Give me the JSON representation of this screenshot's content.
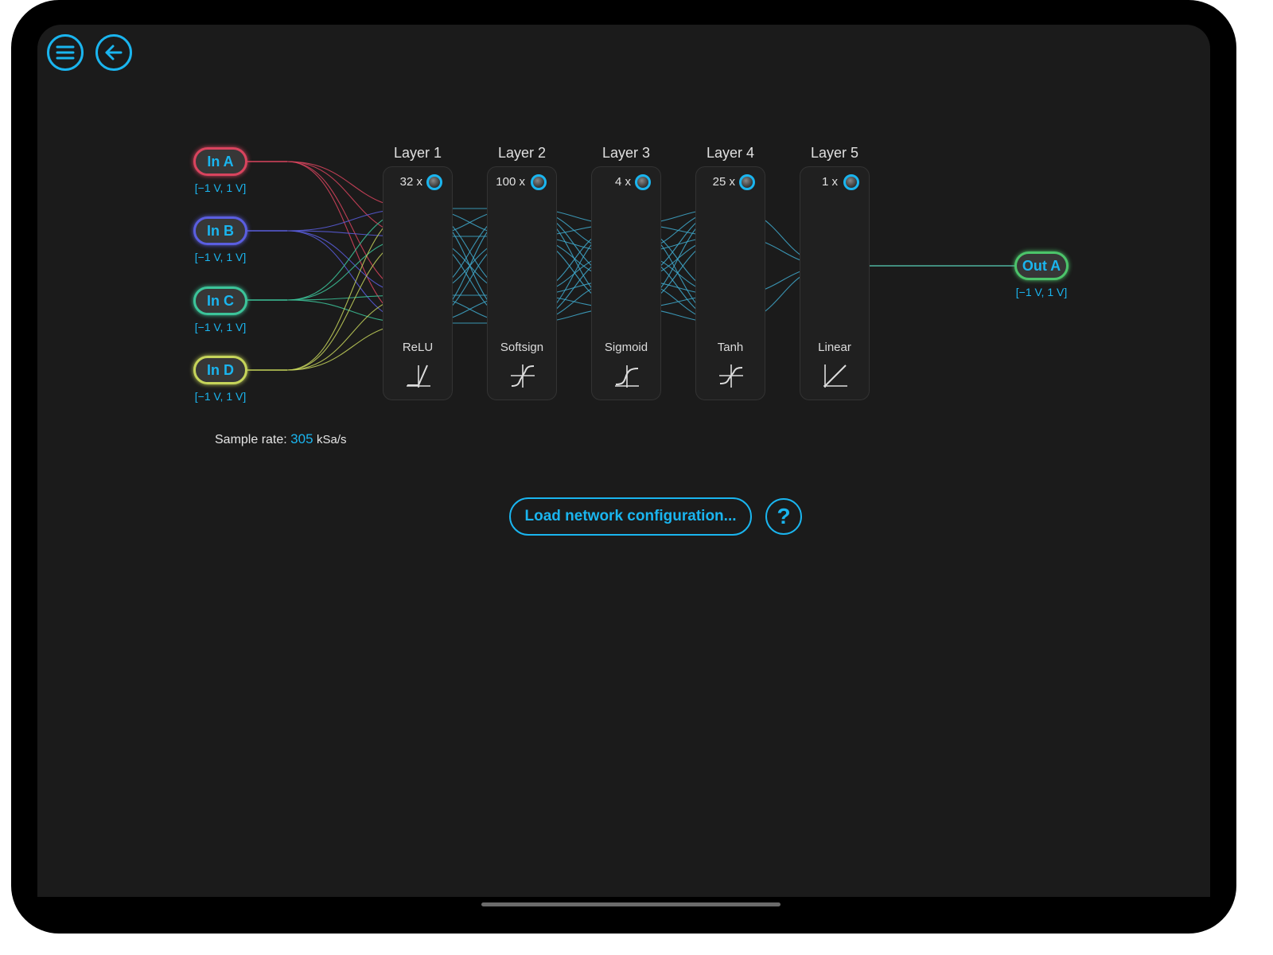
{
  "inputs": [
    {
      "label": "In A",
      "range": "[−1 V, 1 V]",
      "color": "#d9445e"
    },
    {
      "label": "In B",
      "range": "[−1 V, 1 V]",
      "color": "#5a5ee0"
    },
    {
      "label": "In C",
      "range": "[−1 V, 1 V]",
      "color": "#3cc49a"
    },
    {
      "label": "In D",
      "range": "[−1 V, 1 V]",
      "color": "#c6d45a"
    }
  ],
  "layers": [
    {
      "title": "Layer 1",
      "count": "32 x",
      "activation": "ReLU",
      "icon": "relu-icon"
    },
    {
      "title": "Layer 2",
      "count": "100 x",
      "activation": "Softsign",
      "icon": "softsign-icon"
    },
    {
      "title": "Layer 3",
      "count": "4 x",
      "activation": "Sigmoid",
      "icon": "sigmoid-icon"
    },
    {
      "title": "Layer 4",
      "count": "25 x",
      "activation": "Tanh",
      "icon": "tanh-icon"
    },
    {
      "title": "Layer 5",
      "count": "1 x",
      "activation": "Linear",
      "icon": "linear-icon"
    }
  ],
  "output": {
    "label": "Out A",
    "range": "[−1 V, 1 V]",
    "color": "#4cc46a"
  },
  "sample_rate": {
    "label": "Sample rate:",
    "value": "305",
    "unit": "kSa/s"
  },
  "buttons": {
    "load": "Load network configuration...",
    "help": "?"
  },
  "icons": {
    "menu": "menu-icon",
    "back": "back-arrow-icon"
  },
  "colors": {
    "accent": "#1ab5ef",
    "background": "#1b1b1b",
    "connection": "#3fa9cc"
  }
}
